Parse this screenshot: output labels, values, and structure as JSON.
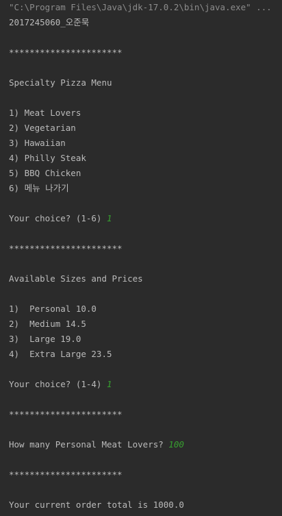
{
  "console": {
    "command_line": "\"C:\\Program Files\\Java\\jdk-17.0.2\\bin\\java.exe\" ...",
    "student_id": "2017245060_오준묵",
    "separator": "**********************",
    "menu_title": "Specialty Pizza Menu",
    "menu_items": [
      "1) Meat Lovers",
      "2) Vegetarian",
      "3) Hawaiian",
      "4) Philly Steak",
      "5) BBQ Chicken",
      "6) 메뉴 나가기"
    ],
    "menu_prompt": "Your choice? (1-6) ",
    "menu_input": "1",
    "sizes_title": "Available Sizes and Prices",
    "size_items": [
      "1)  Personal 10.0",
      "2)  Medium 14.5",
      "3)  Large 19.0",
      "4)  Extra Large 23.5"
    ],
    "size_prompt": "Your choice? (1-4) ",
    "size_input": "1",
    "quantity_prompt": "How many Personal Meat Lovers? ",
    "quantity_input": "100",
    "total_line": "Your current order total is 1000.0"
  }
}
